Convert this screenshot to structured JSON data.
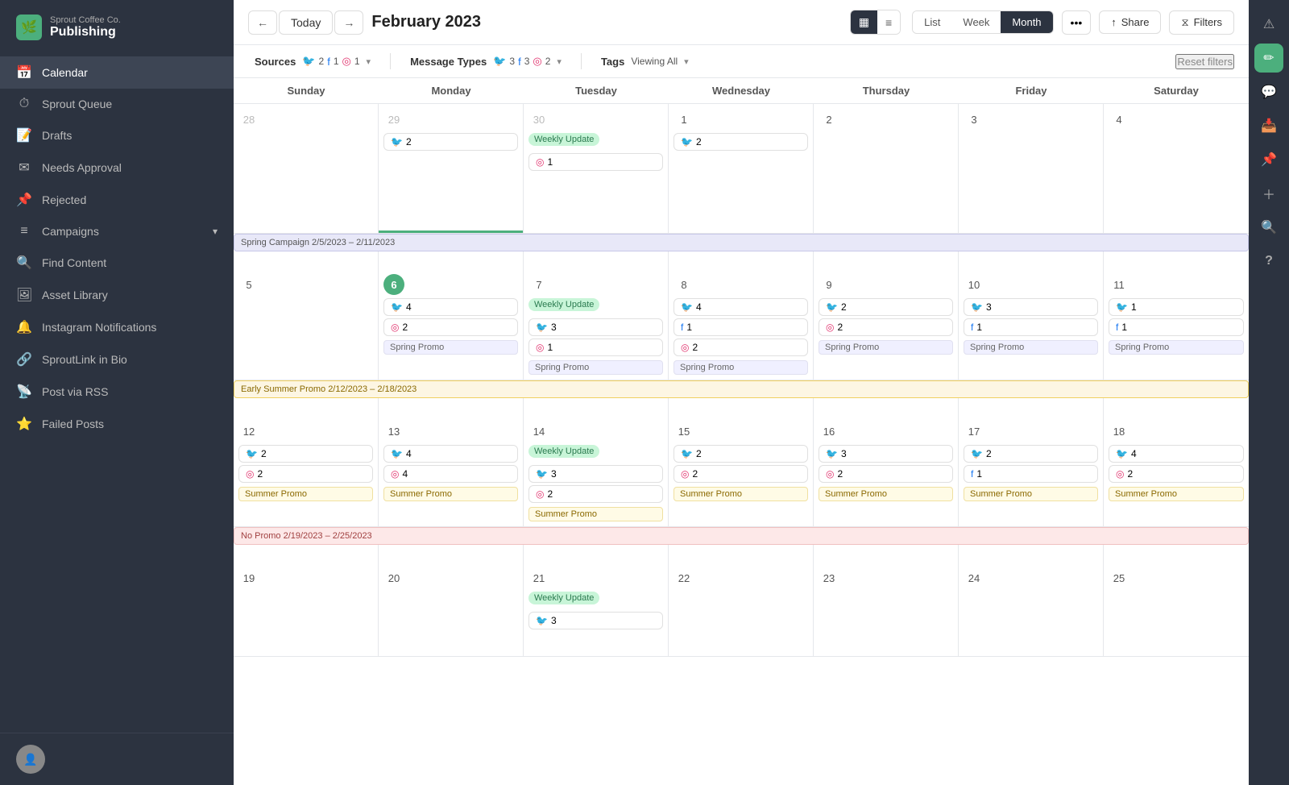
{
  "brand": {
    "company": "Sprout Coffee Co.",
    "app": "Publishing"
  },
  "sidebar": {
    "items": [
      {
        "id": "calendar",
        "label": "Calendar",
        "icon": "📅",
        "active": true
      },
      {
        "id": "sprout-queue",
        "label": "Sprout Queue",
        "icon": "⏱"
      },
      {
        "id": "drafts",
        "label": "Drafts",
        "icon": "📝"
      },
      {
        "id": "needs-approval",
        "label": "Needs Approval",
        "icon": "✉"
      },
      {
        "id": "rejected",
        "label": "Rejected",
        "icon": "📌"
      },
      {
        "id": "campaigns",
        "label": "Campaigns",
        "icon": "≡",
        "hasArrow": true
      },
      {
        "id": "find-content",
        "label": "Find Content",
        "icon": "🔍"
      },
      {
        "id": "asset-library",
        "label": "Asset Library",
        "icon": "🖼"
      },
      {
        "id": "instagram-notifications",
        "label": "Instagram Notifications",
        "icon": "🔔"
      },
      {
        "id": "sproutlink-in-bio",
        "label": "SproutLink in Bio",
        "icon": "🔗"
      },
      {
        "id": "post-via-rss",
        "label": "Post via RSS",
        "icon": "📡"
      },
      {
        "id": "failed-posts",
        "label": "Failed Posts",
        "icon": "⭐"
      }
    ]
  },
  "toolbar": {
    "prev_label": "←",
    "next_label": "→",
    "today_label": "Today",
    "month_title": "February 2023",
    "view_list": "List",
    "view_week": "Week",
    "view_month": "Month",
    "more_label": "•••",
    "share_label": "Share",
    "filter_label": "Filters"
  },
  "filters": {
    "sources_label": "Sources",
    "sources_tw": "2",
    "sources_fb": "1",
    "sources_ig": "1",
    "message_types_label": "Message Types",
    "message_types_tw": "3",
    "message_types_fb": "3",
    "message_types_ig": "2",
    "tags_label": "Tags",
    "tags_value": "Viewing All",
    "reset_label": "Reset filters"
  },
  "calendar": {
    "days": [
      "Sunday",
      "Monday",
      "Tuesday",
      "Wednesday",
      "Thursday",
      "Friday",
      "Saturday"
    ],
    "weeks": [
      {
        "campaign": null,
        "cells": [
          {
            "date": "28",
            "otherMonth": true,
            "posts": []
          },
          {
            "date": "29",
            "otherMonth": true,
            "posts": [
              {
                "type": "tw",
                "count": "2"
              }
            ],
            "todayBar": true
          },
          {
            "date": "30",
            "otherMonth": true,
            "posts": [
              {
                "type": "ig",
                "count": "1"
              }
            ],
            "event": "Weekly Update"
          },
          {
            "date": "1",
            "posts": [
              {
                "type": "tw",
                "count": "2"
              }
            ]
          },
          {
            "date": "2",
            "posts": []
          },
          {
            "date": "3",
            "posts": []
          },
          {
            "date": "4",
            "posts": []
          }
        ]
      },
      {
        "campaign": {
          "label": "Spring Campaign 2/5/2023 – 2/11/2023",
          "type": "spring"
        },
        "cells": [
          {
            "date": "5",
            "posts": []
          },
          {
            "date": "6",
            "posts": [
              {
                "type": "tw",
                "count": "4"
              },
              {
                "type": "ig",
                "count": "2"
              }
            ],
            "promo": "Spring Promo",
            "promoType": "spring"
          },
          {
            "date": "7",
            "posts": [
              {
                "type": "tw",
                "count": "3"
              },
              {
                "type": "ig",
                "count": "1"
              }
            ],
            "event": "Weekly Update",
            "promo": "Spring Promo",
            "promoType": "spring"
          },
          {
            "date": "8",
            "posts": [
              {
                "type": "tw",
                "count": "4"
              },
              {
                "type": "fb",
                "count": "1"
              },
              {
                "type": "ig",
                "count": "2"
              }
            ],
            "promo": "Spring Promo",
            "promoType": "spring"
          },
          {
            "date": "9",
            "posts": [
              {
                "type": "tw",
                "count": "2"
              },
              {
                "type": "ig",
                "count": "2"
              }
            ],
            "promo": "Spring Promo",
            "promoType": "spring"
          },
          {
            "date": "10",
            "posts": [
              {
                "type": "tw",
                "count": "3"
              },
              {
                "type": "fb",
                "count": "1"
              }
            ],
            "promo": "Spring Promo",
            "promoType": "spring"
          },
          {
            "date": "11",
            "posts": [
              {
                "type": "tw",
                "count": "1"
              },
              {
                "type": "fb",
                "count": "1"
              }
            ],
            "promo": "Spring Promo",
            "promoType": "spring"
          }
        ]
      },
      {
        "campaign": {
          "label": "Early Summer Promo 2/12/2023 – 2/18/2023",
          "type": "summer"
        },
        "cells": [
          {
            "date": "12",
            "posts": [
              {
                "type": "tw",
                "count": "2"
              },
              {
                "type": "ig",
                "count": "2"
              }
            ],
            "promo": "Summer Promo",
            "promoType": "summer"
          },
          {
            "date": "13",
            "posts": [
              {
                "type": "tw",
                "count": "4"
              },
              {
                "type": "ig",
                "count": "4"
              }
            ],
            "promo": "Summer Promo",
            "promoType": "summer"
          },
          {
            "date": "14",
            "posts": [
              {
                "type": "tw",
                "count": "3"
              },
              {
                "type": "ig",
                "count": "2"
              }
            ],
            "event": "Weekly Update",
            "promo": "Summer Promo",
            "promoType": "summer"
          },
          {
            "date": "15",
            "posts": [
              {
                "type": "tw",
                "count": "2"
              },
              {
                "type": "ig",
                "count": "2"
              }
            ],
            "promo": "Summer Promo",
            "promoType": "summer"
          },
          {
            "date": "16",
            "posts": [
              {
                "type": "tw",
                "count": "3"
              },
              {
                "type": "ig",
                "count": "2"
              }
            ],
            "promo": "Summer Promo",
            "promoType": "summer"
          },
          {
            "date": "17",
            "posts": [
              {
                "type": "tw",
                "count": "2"
              },
              {
                "type": "fb",
                "count": "1"
              }
            ],
            "promo": "Summer Promo",
            "promoType": "summer"
          },
          {
            "date": "18",
            "posts": [
              {
                "type": "tw",
                "count": "4"
              },
              {
                "type": "ig",
                "count": "2"
              }
            ],
            "promo": "Summer Promo",
            "promoType": "summer"
          }
        ]
      },
      {
        "campaign": {
          "label": "No Promo 2/19/2023 – 2/25/2023",
          "type": "nopromo"
        },
        "cells": [
          {
            "date": "19",
            "posts": []
          },
          {
            "date": "20",
            "posts": []
          },
          {
            "date": "21",
            "posts": [],
            "event": "Weekly Update"
          },
          {
            "date": "22",
            "posts": []
          },
          {
            "date": "23",
            "posts": []
          },
          {
            "date": "24",
            "posts": []
          },
          {
            "date": "25",
            "posts": []
          }
        ]
      }
    ]
  },
  "right_bar_icons": [
    {
      "id": "alert-icon",
      "symbol": "⚠",
      "accent": false
    },
    {
      "id": "compose-icon",
      "symbol": "✏",
      "accent": true
    },
    {
      "id": "messages-icon",
      "symbol": "💬",
      "accent": false
    },
    {
      "id": "inbox-icon",
      "symbol": "📥",
      "accent": false
    },
    {
      "id": "pin-icon",
      "symbol": "📌",
      "accent": false
    },
    {
      "id": "plus-icon",
      "symbol": "＋",
      "accent": false
    },
    {
      "id": "search-icon",
      "symbol": "🔍",
      "accent": false
    },
    {
      "id": "help-icon",
      "symbol": "?",
      "accent": false
    }
  ]
}
